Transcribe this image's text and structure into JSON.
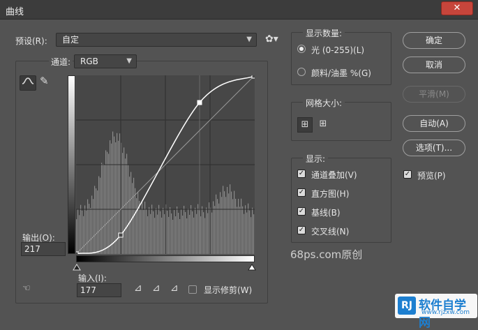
{
  "window": {
    "title": "曲线",
    "close_label": "✕"
  },
  "preset": {
    "label": "预设(R):",
    "value": "自定"
  },
  "channel": {
    "label": "通道:",
    "value": "RGB"
  },
  "output": {
    "label": "输出(O):",
    "value": "217"
  },
  "input": {
    "label": "输入(I):",
    "value": "177"
  },
  "show_clipping": {
    "label": "显示修剪(W)",
    "checked": false
  },
  "display_amount": {
    "title": "显示数量:",
    "options": [
      {
        "label": "光 (0-255)(L)",
        "selected": true
      },
      {
        "label": "颜料/油墨 %(G)",
        "selected": false
      }
    ]
  },
  "grid_size": {
    "title": "网格大小:"
  },
  "show": {
    "title": "显示:",
    "options": [
      {
        "label": "通道叠加(V)",
        "checked": true
      },
      {
        "label": "直方图(H)",
        "checked": true
      },
      {
        "label": "基线(B)",
        "checked": true
      },
      {
        "label": "交叉线(N)",
        "checked": true
      }
    ]
  },
  "buttons": {
    "ok": "确定",
    "cancel": "取消",
    "smooth": "平滑(M)",
    "auto": "自动(A)",
    "options": "选项(T)..."
  },
  "preview": {
    "label": "预览(P)",
    "checked": true
  },
  "watermark": {
    "text": "68ps.com原创",
    "logo_text": "软件自学网",
    "logo_sub": "www.rjzxw.com",
    "logo_mark": "RJ"
  },
  "colors": {
    "accent": "#1d7fd0",
    "panel": "#535353",
    "graph": "#474747"
  },
  "curve": {
    "points": [
      [
        0,
        0
      ],
      [
        64,
        27
      ],
      [
        177,
        217
      ],
      [
        255,
        255
      ]
    ]
  }
}
